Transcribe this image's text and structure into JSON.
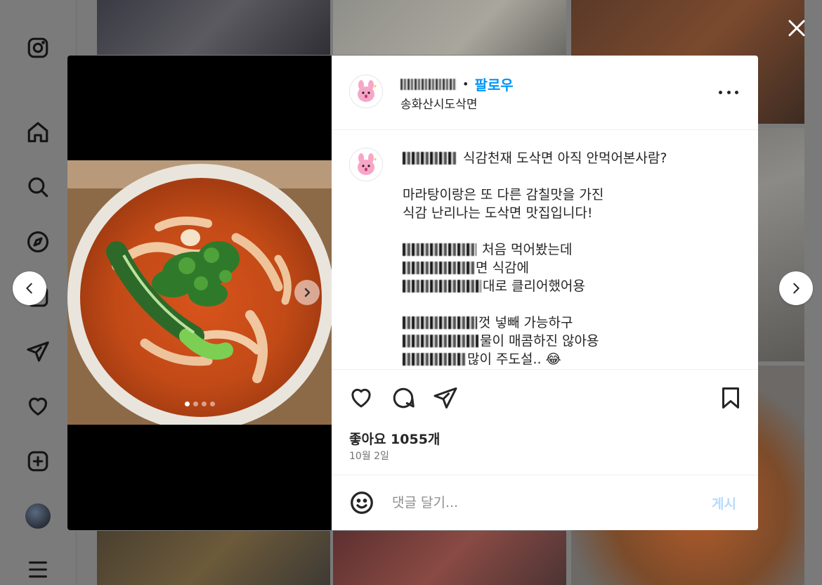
{
  "sidebar": {
    "items": [
      {
        "name": "instagram-logo-icon"
      },
      {
        "name": "home-icon"
      },
      {
        "name": "search-icon"
      },
      {
        "name": "explore-icon"
      },
      {
        "name": "messages-icon"
      },
      {
        "name": "notifications-heart-icon"
      },
      {
        "name": "create-icon"
      },
      {
        "name": "profile-avatar"
      },
      {
        "name": "menu-icon"
      }
    ]
  },
  "post": {
    "header": {
      "separator": "•",
      "follow_label": "팔로우",
      "location": "송화산시도삭면"
    },
    "caption": {
      "first_line": "식감천재 도삭면 아직 안먹어본사람?",
      "para1": [
        "마라탕이랑은 또 다른 감칠맛을 가진",
        "식감 난리나는 도삭면 맛집입니다!"
      ],
      "para2": [
        "처음 먹어봤는데",
        "면 식감에",
        "대로 클리어했어용"
      ],
      "para3": [
        "껏 넣빼 가능하구",
        "물이 매콤하진 않아용",
        "많이 주도설.. 😂"
      ]
    },
    "likes_label": "좋아요 1055개",
    "date": "10월 2일",
    "carousel": {
      "total": 4,
      "current": 1
    }
  },
  "comment": {
    "placeholder": "댓글 달기...",
    "post_label": "게시"
  },
  "colors": {
    "accent": "#0095f6",
    "post_button_disabled": "#b3dbff",
    "overlay": "#7a7a7a"
  }
}
